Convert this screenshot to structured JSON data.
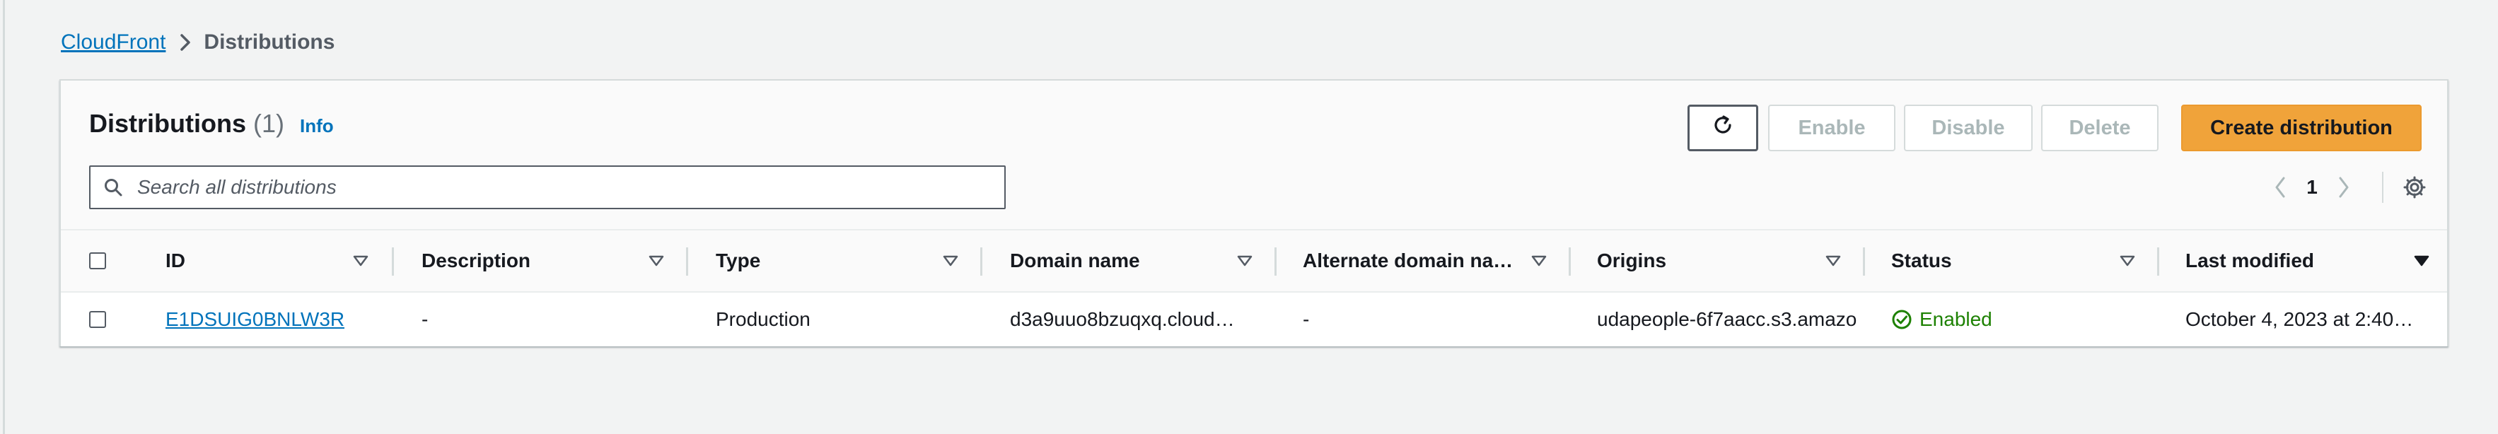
{
  "breadcrumb": {
    "root": "CloudFront",
    "current": "Distributions"
  },
  "panel": {
    "title": "Distributions",
    "count": "(1)",
    "info_label": "Info"
  },
  "toolbar": {
    "refresh_icon": "refresh-icon",
    "enable_label": "Enable",
    "disable_label": "Disable",
    "delete_label": "Delete",
    "create_label": "Create distribution"
  },
  "search": {
    "placeholder": "Search all distributions",
    "value": ""
  },
  "pagination": {
    "current_page": "1"
  },
  "table": {
    "columns": [
      "ID",
      "Description",
      "Type",
      "Domain name",
      "Alternate domain na…",
      "Origins",
      "Status",
      "Last modified"
    ],
    "rows": [
      {
        "id": "E1DSUIG0BNLW3R",
        "description": "-",
        "type": "Production",
        "domain_name": "d3a9uuo8bzuqxq.cloud…",
        "alternate_domain": "-",
        "origins": "udapeople-6f7aacc.s3.amazo",
        "status": "Enabled",
        "last_modified": "October 4, 2023 at 2:40…"
      }
    ]
  },
  "colors": {
    "link": "#0073bb",
    "primary_button": "#f0a33a",
    "status_enabled": "#1d8102",
    "disabled_text": "#aab7b8"
  }
}
